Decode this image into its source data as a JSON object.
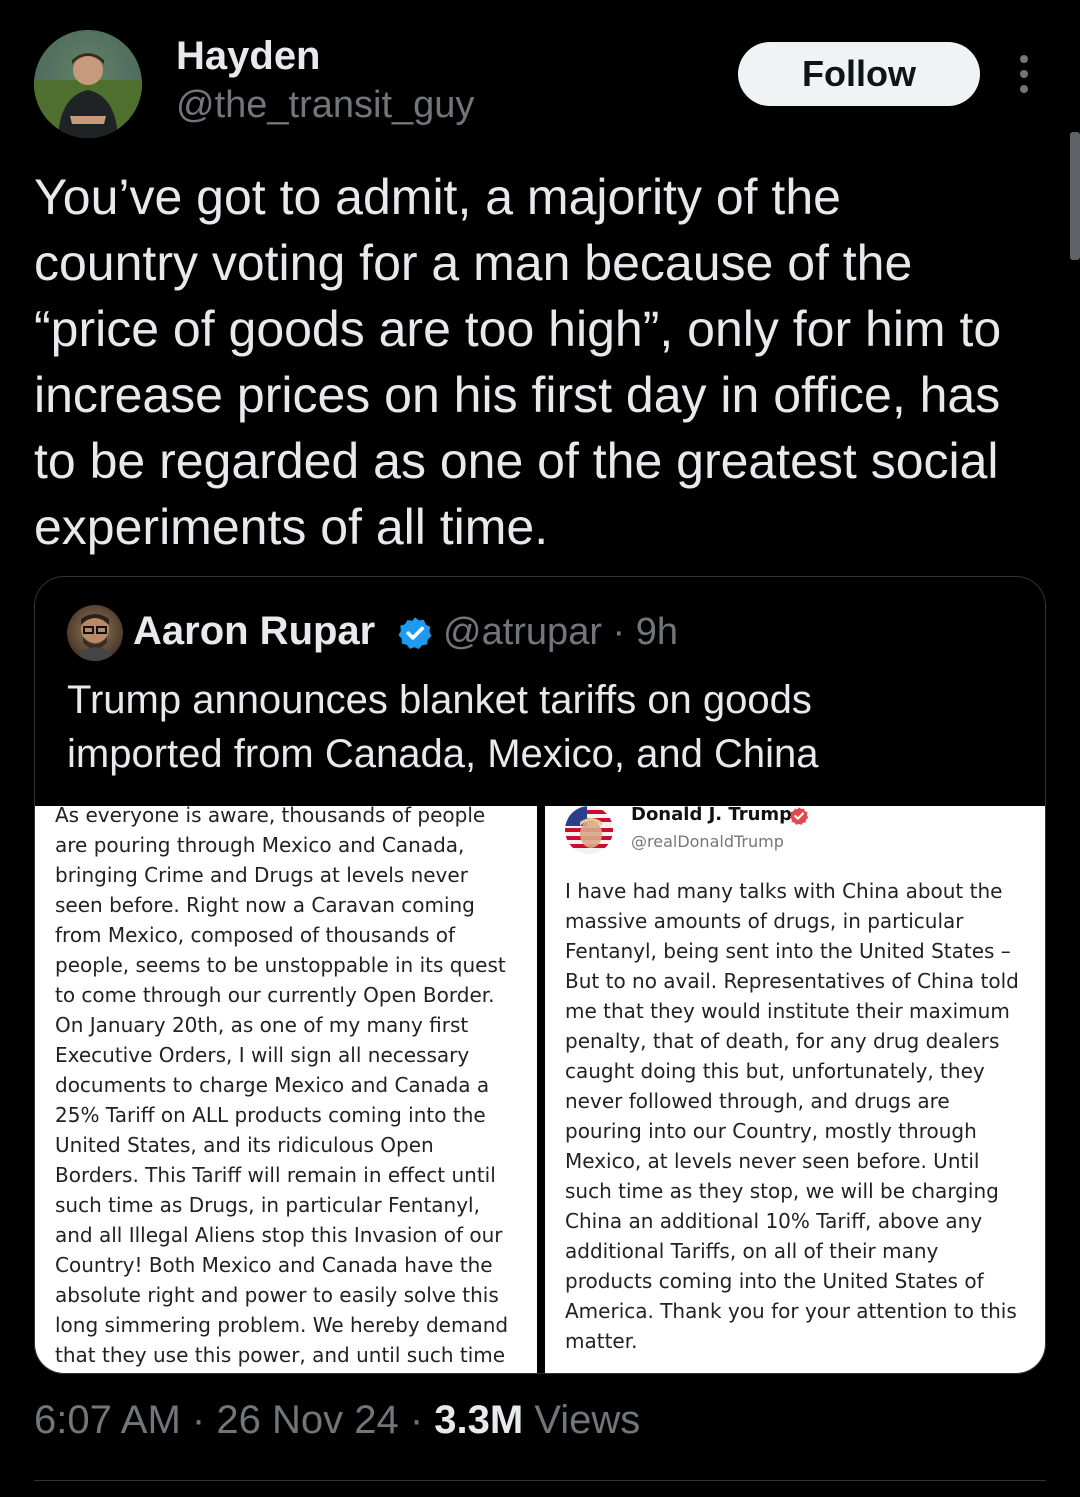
{
  "tweet": {
    "author_name": "Hayden",
    "author_handle": "@the_transit_guy",
    "follow_label": "Follow",
    "text": "You’ve got to admit, a majority of the\ncountry voting for a man because of the\n“price of goods are too high”, only for him to\nincrease prices on his first day in office, has\nto be regarded as one of the greatest social\nexperiments of all time.",
    "time": "6:07 AM",
    "date": "26 Nov 24",
    "views_count": "3.3M",
    "views_label": "Views",
    "separator": "·"
  },
  "quote": {
    "author_name": "Aaron Rupar",
    "author_handle_time": "@atrupar · 9h",
    "text": "Trump announces blanket tariffs on goods\nimported from Canada, Mexico, and China",
    "left_post_text": "As everyone is aware, thousands of people\nare pouring through Mexico and Canada,\nbringing Crime and Drugs at levels never\nseen before. Right now a Caravan coming\nfrom Mexico, composed of thousands of\npeople, seems to be unstoppable in its quest\nto come through our currently Open Border.\nOn January 20th, as one of my many first\nExecutive Orders, I will sign all necessary\ndocuments to charge Mexico and Canada a\n25% Tariff on ALL products coming into the\nUnited States, and its ridiculous Open\nBorders. This Tariff will remain in effect until\nsuch time as Drugs, in particular Fentanyl,\nand all Illegal Aliens stop this Invasion of our\nCountry! Both Mexico and Canada have the\nabsolute right and power to easily solve this\nlong simmering problem. We hereby demand\nthat they use this power, and until such time",
    "right_post_author": "Donald J. Trump",
    "right_post_handle": "@realDonaldTrump",
    "right_post_text": "I have had many talks with China about the\nmassive amounts of drugs, in particular\nFentanyl, being sent into the United States –\nBut to no avail. Representatives of China told\nme that they would institute their maximum\npenalty, that of death, for any drug dealers\ncaught doing this but, unfortunately, they\nnever followed through, and drugs are\npouring into our Country, mostly through\nMexico, at levels never seen before. Until\nsuch time as they stop, we will be charging\nChina an additional 10% Tariff, above any\nadditional Tariffs, on all of their many\nproducts coming into the United States of\nAmerica. Thank you for your attention to this\nmatter."
  },
  "colors": {
    "background": "#000000",
    "text_primary": "#e7e9ea",
    "text_secondary": "#71767b",
    "verified_blue": "#1d9bf0",
    "truth_verified": "#e5484d",
    "follow_bg": "#eff3f4"
  },
  "icons": {
    "more": "more-vertical-icon",
    "verified": "verified-badge-icon"
  }
}
